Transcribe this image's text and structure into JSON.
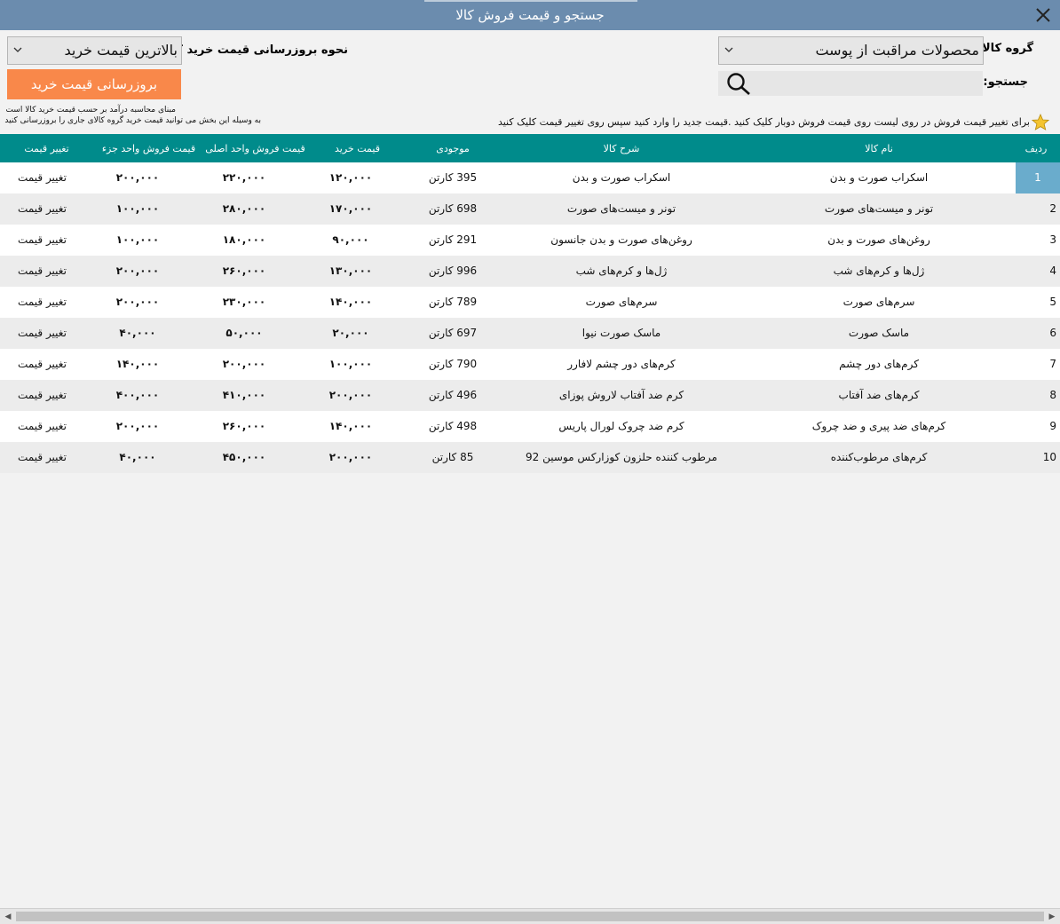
{
  "window": {
    "title": "جستجو و قیمت فروش کالا"
  },
  "form": {
    "group_label": "گروه کالا:",
    "group_value": "محصولات مراقبت از پوست",
    "search_label": "جستجو:",
    "search_value": "",
    "update_mode_label": "نحوه بروزرسانی قیمت خرید کالا :",
    "update_mode_value": "بالاترین قیمت خرید",
    "update_button": "بروزرسانی قیمت خرید",
    "note1": "مبنای محاسبه درآمد بر حسب قیمت خرید کالا است",
    "note2": "به وسیله این بخش می توانید قیمت خرید گروه کالای جاری را بروزرسانی کنید",
    "hint": "برای تغییر قیمت فروش در روی لیست روی قیمت فروش دوبار کلیک کنید .قیمت جدید را وارد کنید سپس روی تغییر قیمت کلیک کنید"
  },
  "columns": {
    "row": "ردیف",
    "name": "نام کالا",
    "desc": "شرح کالا",
    "stock": "موجودی",
    "buy": "قیمت خرید",
    "sell_main": "قیمت فروش   واحد اصلی",
    "sell_sub": "قیمت فروش واحد جزء",
    "action": "تغییر قیمت"
  },
  "rows": [
    {
      "n": "1",
      "name": "اسکراب صورت و بدن",
      "desc": "اسکراب صورت و بدن",
      "stock": "395 کارتن",
      "buy": "۱۲۰,۰۰۰",
      "sell_main": "۲۲۰,۰۰۰",
      "sell_sub": "۲۰۰,۰۰۰",
      "action": "تغییر قیمت"
    },
    {
      "n": "2",
      "name": "تونر و میست‌های صورت",
      "desc": "تونر و میست‌های صورت",
      "stock": "698 کارتن",
      "buy": "۱۷۰,۰۰۰",
      "sell_main": "۲۸۰,۰۰۰",
      "sell_sub": "۱۰۰,۰۰۰",
      "action": "تغییر قیمت"
    },
    {
      "n": "3",
      "name": "روغن‌های صورت و بدن",
      "desc": "روغن‌های صورت و بدن جانسون",
      "stock": "291 کارتن",
      "buy": "۹۰,۰۰۰",
      "sell_main": "۱۸۰,۰۰۰",
      "sell_sub": "۱۰۰,۰۰۰",
      "action": "تغییر قیمت"
    },
    {
      "n": "4",
      "name": "ژل‌ها و کرم‌های شب",
      "desc": "ژل‌ها و کرم‌های شب",
      "stock": "996 کارتن",
      "buy": "۱۳۰,۰۰۰",
      "sell_main": "۲۶۰,۰۰۰",
      "sell_sub": "۲۰۰,۰۰۰",
      "action": "تغییر قیمت"
    },
    {
      "n": "5",
      "name": "سرم‌های صورت",
      "desc": "سرم‌های صورت",
      "stock": "789 کارتن",
      "buy": "۱۴۰,۰۰۰",
      "sell_main": "۲۳۰,۰۰۰",
      "sell_sub": "۲۰۰,۰۰۰",
      "action": "تغییر قیمت"
    },
    {
      "n": "6",
      "name": "ماسک صورت",
      "desc": "ماسک صورت نیوا",
      "stock": "697 کارتن",
      "buy": "۲۰,۰۰۰",
      "sell_main": "۵۰,۰۰۰",
      "sell_sub": "۴۰,۰۰۰",
      "action": "تغییر قیمت"
    },
    {
      "n": "7",
      "name": "کرم‌های دور چشم",
      "desc": "کرم‌های دور چشم لافارر",
      "stock": "790 کارتن",
      "buy": "۱۰۰,۰۰۰",
      "sell_main": "۲۰۰,۰۰۰",
      "sell_sub": "۱۴۰,۰۰۰",
      "action": "تغییر قیمت"
    },
    {
      "n": "8",
      "name": "کرم‌های ضد آفتاب",
      "desc": "کرم ضد آفتاب لاروش پوزای",
      "stock": "496 کارتن",
      "buy": "۲۰۰,۰۰۰",
      "sell_main": "۴۱۰,۰۰۰",
      "sell_sub": "۴۰۰,۰۰۰",
      "action": "تغییر قیمت"
    },
    {
      "n": "9",
      "name": "کرم‌های ضد پیری و ضد چروک",
      "desc": "کرم ضد چروک لورال پاریس",
      "stock": "498 کارتن",
      "buy": "۱۴۰,۰۰۰",
      "sell_main": "۲۶۰,۰۰۰",
      "sell_sub": "۲۰۰,۰۰۰",
      "action": "تغییر قیمت"
    },
    {
      "n": "10",
      "name": "کرم‌های مرطوب‌کننده",
      "desc": "مرطوب کننده حلزون کوزارکس موسین 92",
      "stock": "85 کارتن",
      "buy": "۲۰۰,۰۰۰",
      "sell_main": "۴۵۰,۰۰۰",
      "sell_sub": "۴۰,۰۰۰",
      "action": "تغییر قیمت"
    }
  ],
  "colors": {
    "titlebar": "#6b8cae",
    "header": "#008b8b",
    "button": "#f9884a",
    "selected": "#6aaccc"
  },
  "icons": {
    "close": "close-icon",
    "search": "search-icon",
    "star": "star-icon",
    "dropdown": "chevron-down-icon"
  }
}
